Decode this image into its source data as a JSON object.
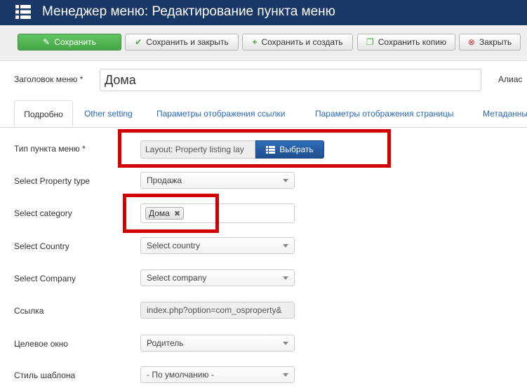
{
  "header": {
    "title": "Менеджер меню: Редактирование пункта меню",
    "icon": "list-icon"
  },
  "toolbar": {
    "save": "Сохранить",
    "save_close": "Сохранить и закрыть",
    "save_new": "Сохранить и создать",
    "save_copy": "Сохранить копию",
    "close": "Закрыть"
  },
  "form": {
    "title_label": "Заголовок меню *",
    "title_value": "Дома",
    "alias_label": "Алиас"
  },
  "tabs": [
    "Подробно",
    "Other setting",
    "Параметры отображения ссылки",
    "Параметры отображения страницы",
    "Метаданны"
  ],
  "fields": {
    "item_type_label": "Тип пункта меню *",
    "item_type_value": "Layout: Property listing lay",
    "choose_button": "Выбрать",
    "property_type_label": "Select Property type",
    "property_type_value": "Продажа",
    "category_label": "Select category",
    "category_tag": "Дома",
    "country_label": "Select Country",
    "country_value": "Select country",
    "company_label": "Select Company",
    "company_value": "Select company",
    "link_label": "Ссылка",
    "link_value": "index.php?option=com_osproperty&",
    "target_label": "Целевое окно",
    "target_value": "Родитель",
    "template_label": "Стиль шаблона",
    "template_value": "- По умолчанию -"
  },
  "colors": {
    "header_bg": "#1a3867",
    "success": "#46a546",
    "highlight": "#d40000",
    "primary": "#1f4f8f"
  }
}
